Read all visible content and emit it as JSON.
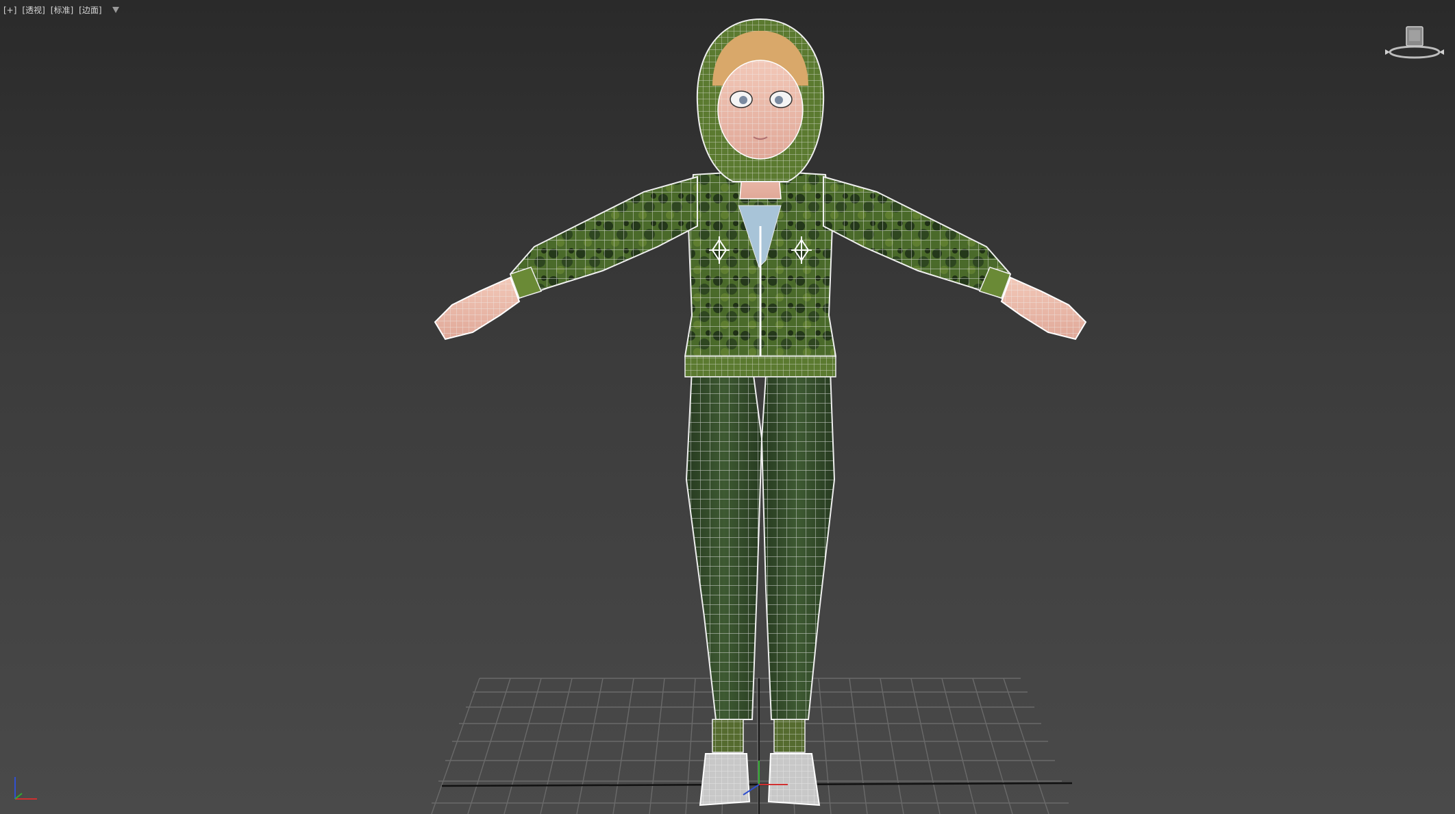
{
  "viewport": {
    "labels": [
      "[+]",
      "[透视]",
      "[标准]",
      "[边面]"
    ]
  },
  "icons": {
    "filter": "filter-icon",
    "viewcube": "viewcube-icon",
    "axis": "axis-tripod-icon"
  },
  "colors": {
    "background_top": "#2a2a2a",
    "background_bottom": "#4a4a4a",
    "grid": "#6a6a6a",
    "wire": "#e8e8e8",
    "jacket": "#3f5a2a",
    "pants": "#32482a",
    "skin": "#e8b8a8",
    "hair": "#d9a86a",
    "axis_x": "#d03030",
    "axis_y": "#30b030",
    "axis_z": "#3050d0"
  }
}
